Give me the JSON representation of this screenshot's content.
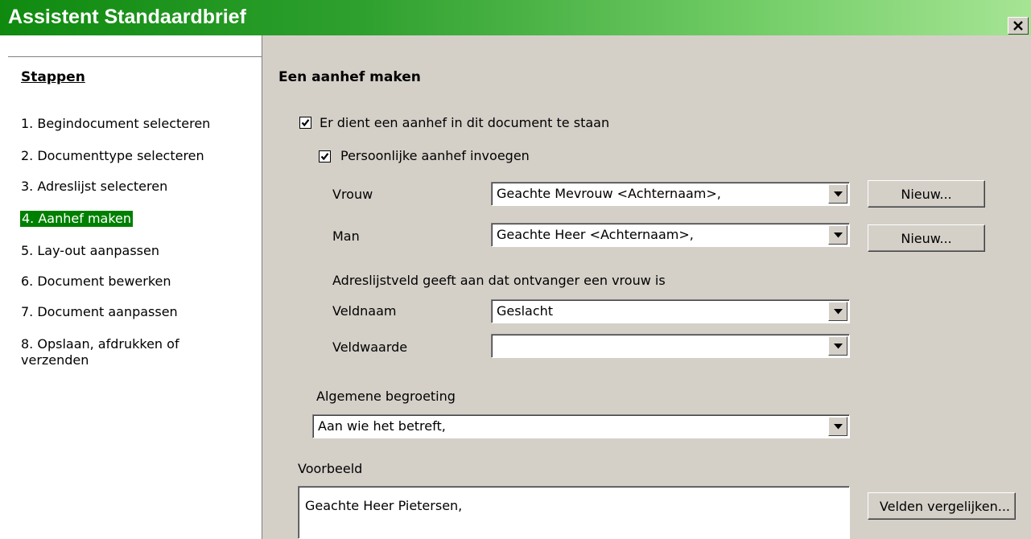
{
  "window": {
    "title": "Assistent Standaardbrief",
    "close_icon": "close-icon"
  },
  "sidebar": {
    "heading": "Stappen",
    "steps": [
      {
        "label": "1. Begindocument selecteren"
      },
      {
        "label": "2. Documenttype selecteren"
      },
      {
        "label": "3. Adreslijst selecteren"
      },
      {
        "label": "4. Aanhef maken",
        "active": true
      },
      {
        "label": "5. Lay-out aanpassen"
      },
      {
        "label": "6. Document bewerken"
      },
      {
        "label": "7. Document aanpassen"
      },
      {
        "label": "8. Opslaan, afdrukken of verzenden"
      }
    ]
  },
  "main": {
    "heading": "Een aanhef maken",
    "include_salutation": {
      "label": "Er dient een aanhef in dit document te staan",
      "checked": true
    },
    "personal_salutation": {
      "label": "Persoonlijke aanhef invoegen",
      "checked": true
    },
    "female": {
      "label": "Vrouw",
      "value": "Geachte Mevrouw <Achternaam>,",
      "new_button": "Nieuw..."
    },
    "male": {
      "label": "Man",
      "value": "Geachte Heer <Achternaam>,",
      "new_button": "Nieuw..."
    },
    "address_field_note": "Adreslijstveld geeft aan dat ontvanger een vrouw is",
    "field_name": {
      "label": "Veldnaam",
      "value": "Geslacht"
    },
    "field_value": {
      "label": "Veldwaarde",
      "value": ""
    },
    "general_salutation": {
      "label": "Algemene begroeting",
      "value": "Aan wie het betreft,"
    },
    "preview": {
      "label": "Voorbeeld",
      "text": "Geachte Heer Pietersen,",
      "match_button": "Velden vergelijken..."
    }
  }
}
